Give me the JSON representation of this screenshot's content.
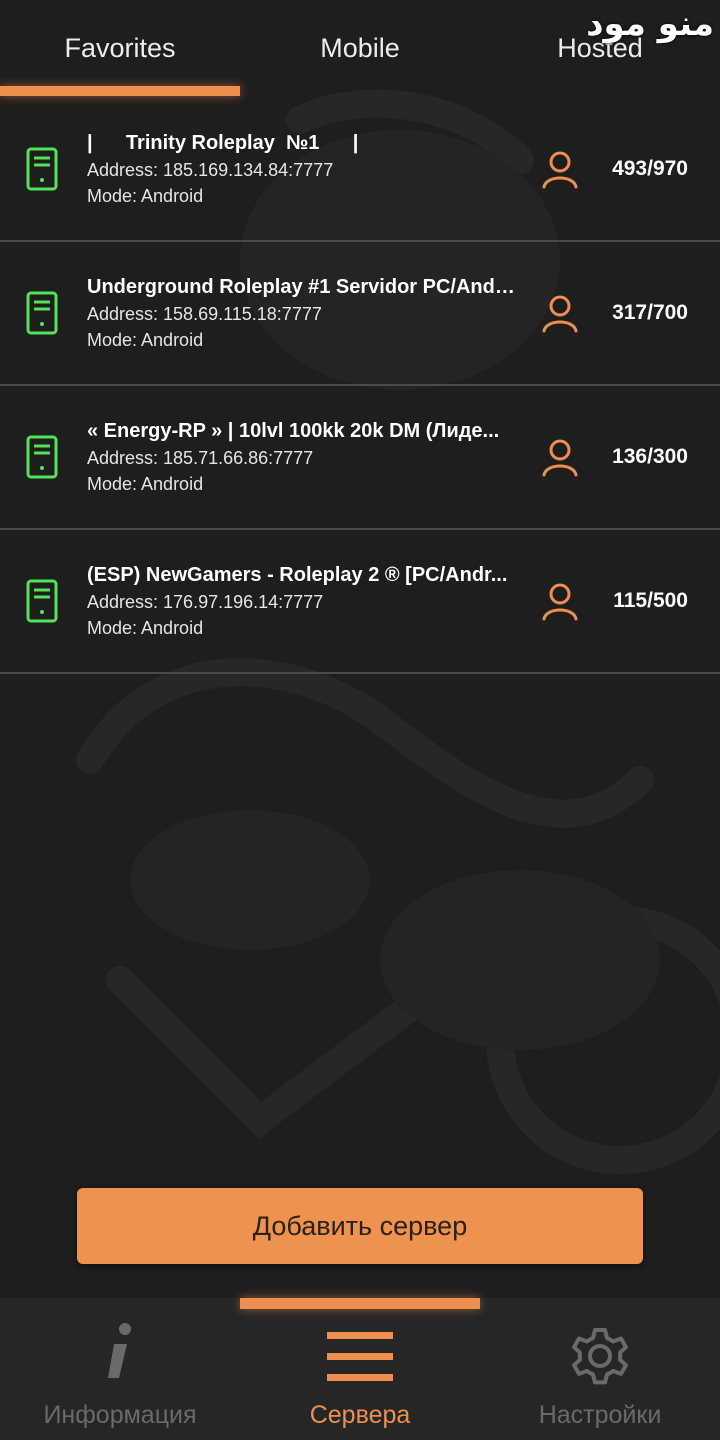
{
  "tabs": [
    {
      "label": "Favorites",
      "active": true
    },
    {
      "label": "Mobile",
      "active": false
    },
    {
      "label": "Hosted",
      "active": false
    }
  ],
  "watermark": "ﻣﻨﻮ ﻣﻮﺩ",
  "servers": [
    {
      "name": "|      Trinity Roleplay  №1      |",
      "address": "Address: 185.169.134.84:7777",
      "mode": "Mode: Android",
      "players": "493/970"
    },
    {
      "name": "Underground Roleplay #1 Servidor PC/Andr...",
      "address": "Address: 158.69.115.18:7777",
      "mode": "Mode: Android",
      "players": "317/700"
    },
    {
      "name": "« Energy-RP » | 10lvl 100kk 20k DM (Лиде...",
      "address": "Address: 185.71.66.86:7777",
      "mode": "Mode: Android",
      "players": "136/300"
    },
    {
      "name": "(ESP) NewGamers - Roleplay 2 ® [PC/Andr...",
      "address": "Address: 176.97.196.14:7777",
      "mode": "Mode: Android",
      "players": "115/500"
    }
  ],
  "add_button": {
    "label": "Добавить сервер"
  },
  "bottom_nav": [
    {
      "label": "Информация",
      "icon": "info-icon",
      "active": false
    },
    {
      "label": "Сервера",
      "icon": "menu-icon",
      "active": true
    },
    {
      "label": "Настройки",
      "icon": "gear-icon",
      "active": false
    }
  ],
  "colors": {
    "accent": "#ef8f4f",
    "server_icon": "#52e35a",
    "background": "#1e1e1e",
    "nav_inactive": "#6a6a6a"
  }
}
